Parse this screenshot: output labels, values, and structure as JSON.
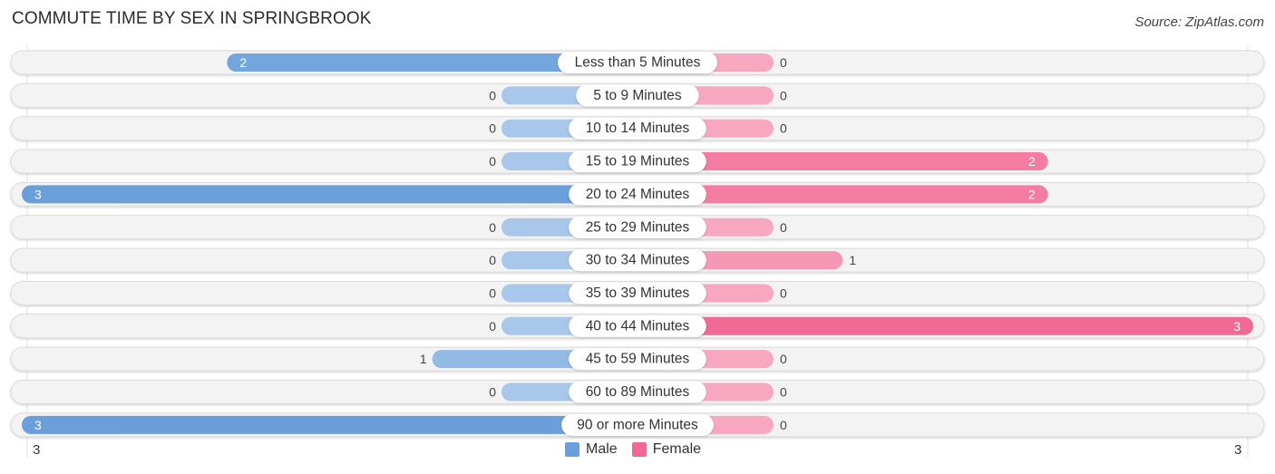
{
  "title": "COMMUTE TIME BY SEX IN SPRINGBROOK",
  "source": "Source: ZipAtlas.com",
  "colors": {
    "male_full": "#6a9fdc",
    "male_light": "#a9c7eb",
    "female_full": "#f06a95",
    "female_light": "#f7a8c0",
    "row_bg": "#f3f3f3",
    "row_border": "#dcdcdc"
  },
  "chart_data": {
    "type": "bar",
    "orientation": "horizontal-diverging",
    "title": "COMMUTE TIME BY SEX IN SPRINGBROOK",
    "categories": [
      "Less than 5 Minutes",
      "5 to 9 Minutes",
      "10 to 14 Minutes",
      "15 to 19 Minutes",
      "20 to 24 Minutes",
      "25 to 29 Minutes",
      "30 to 34 Minutes",
      "35 to 39 Minutes",
      "40 to 44 Minutes",
      "45 to 59 Minutes",
      "60 to 89 Minutes",
      "90 or more Minutes"
    ],
    "series": [
      {
        "name": "Male",
        "values": [
          2,
          0,
          0,
          0,
          3,
          0,
          0,
          0,
          0,
          1,
          0,
          3
        ]
      },
      {
        "name": "Female",
        "values": [
          0,
          0,
          0,
          2,
          2,
          0,
          1,
          0,
          3,
          0,
          0,
          0
        ]
      }
    ],
    "xlim": [
      3,
      3
    ],
    "axis_left_label": "3",
    "axis_right_label": "3",
    "legend": {
      "position": "bottom-center",
      "entries": [
        "Male",
        "Female"
      ]
    }
  }
}
